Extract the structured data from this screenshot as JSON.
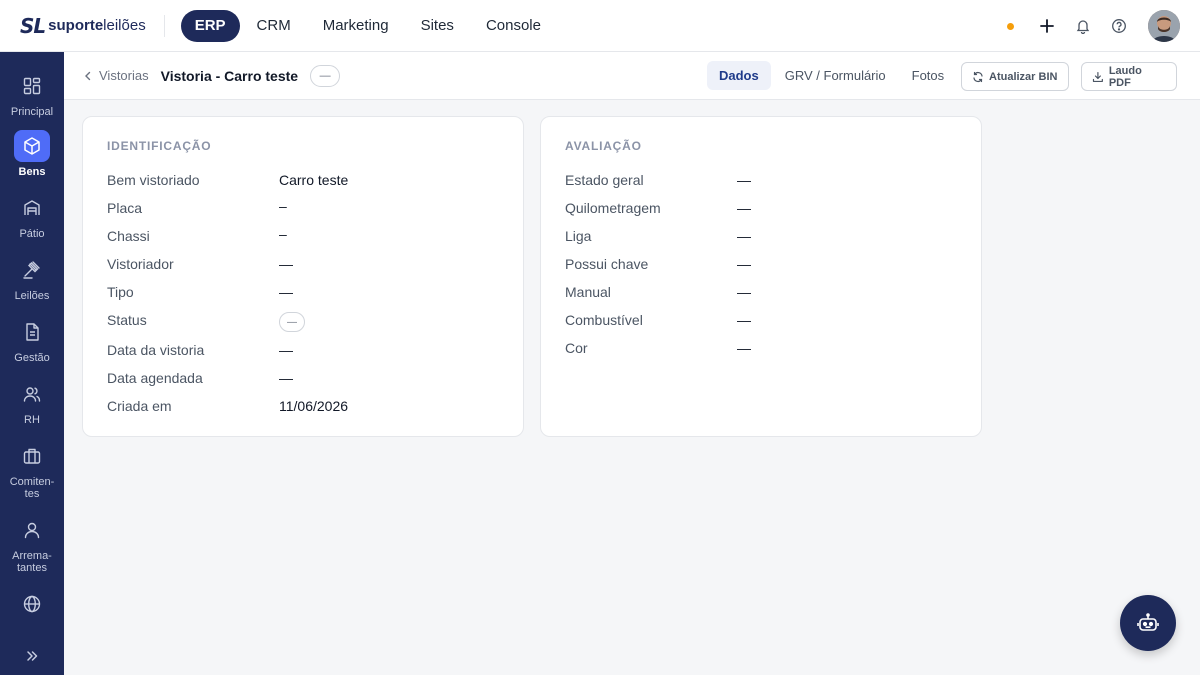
{
  "brand": {
    "mark": "SL",
    "name_bold": "suporte",
    "name_light": "leilões"
  },
  "top_nav": [
    {
      "label": "ERP",
      "active": true
    },
    {
      "label": "CRM",
      "active": false
    },
    {
      "label": "Marketing",
      "active": false
    },
    {
      "label": "Sites",
      "active": false
    },
    {
      "label": "Console",
      "active": false
    }
  ],
  "top_icons": [
    "status-dot",
    "plus-icon",
    "bell-icon",
    "help-icon",
    "user-avatar"
  ],
  "sidebar": {
    "items": [
      {
        "label": "Principal",
        "icon": "grid-icon",
        "active": false
      },
      {
        "label": "Bens",
        "icon": "box-icon",
        "active": true
      },
      {
        "label": "Pátio",
        "icon": "warehouse-icon",
        "active": false
      },
      {
        "label": "Leilões",
        "icon": "gavel-icon",
        "active": false
      },
      {
        "label": "Gestão",
        "icon": "document-icon",
        "active": false
      },
      {
        "label": "RH",
        "icon": "users-icon",
        "active": false
      },
      {
        "label": "Comiten-\ntes",
        "icon": "briefcase-icon",
        "active": false
      },
      {
        "label": "Arrema-\ntantes",
        "icon": "user-icon",
        "active": false
      },
      {
        "label": "",
        "icon": "globe-icon",
        "active": false
      }
    ],
    "expand_icon": "chevrons-right-icon"
  },
  "subheader": {
    "breadcrumb": "Vistorias",
    "title": "Vistoria - Carro teste",
    "badge": "—",
    "tabs": [
      {
        "label": "Dados",
        "active": true
      },
      {
        "label": "GRV / Formulário",
        "active": false
      },
      {
        "label": "Fotos",
        "active": false
      }
    ],
    "refresh_button": "Atualizar BIN",
    "pdf_button": "Laudo PDF"
  },
  "identificacao": {
    "title": "IDENTIFICAÇÃO",
    "rows": [
      {
        "label": "Bem vistoriado",
        "value": "Carro teste"
      },
      {
        "label": "Placa",
        "value": "–"
      },
      {
        "label": "Chassi",
        "value": "–"
      },
      {
        "label": "Vistoriador",
        "value": "—"
      },
      {
        "label": "Tipo",
        "value": "—"
      },
      {
        "label": "Status",
        "value": "—"
      },
      {
        "label": "Data da vistoria",
        "value": "—"
      },
      {
        "label": "Data agendada",
        "value": "—"
      },
      {
        "label": "Criada em",
        "value": "11/06/2026"
      }
    ]
  },
  "avaliacao": {
    "title": "AVALIAÇÃO",
    "rows": [
      {
        "label": "Estado geral",
        "value": "—"
      },
      {
        "label": "Quilometragem",
        "value": "—"
      },
      {
        "label": "Liga",
        "value": "—"
      },
      {
        "label": "Possui chave",
        "value": "—"
      },
      {
        "label": "Manual",
        "value": "—"
      },
      {
        "label": "Combustível",
        "value": "—"
      },
      {
        "label": "Cor",
        "value": "—"
      }
    ]
  },
  "assistant_button": "robot-icon",
  "colors": {
    "primary": "#1e2a5a",
    "accent": "#4f6cf7",
    "status_dot": "#f59e0b"
  }
}
